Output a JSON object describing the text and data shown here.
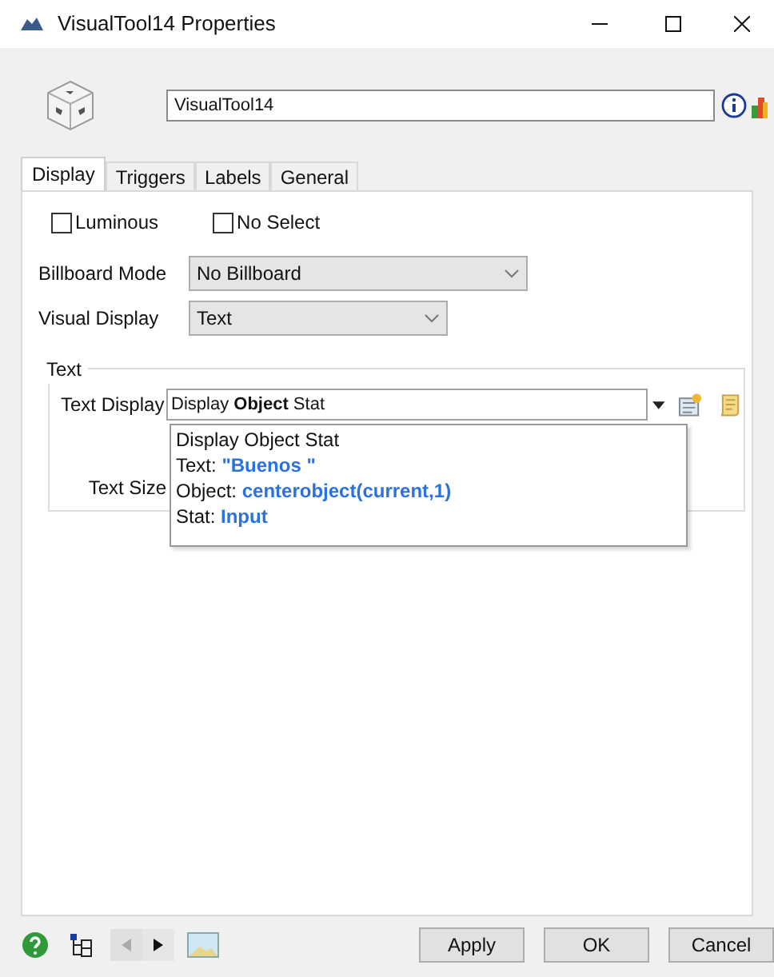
{
  "window": {
    "title": "VisualTool14  Properties"
  },
  "name_field": {
    "value": "VisualTool14"
  },
  "tabs": [
    {
      "label": "Display",
      "selected": true
    },
    {
      "label": "Triggers",
      "selected": false
    },
    {
      "label": "Labels",
      "selected": false
    },
    {
      "label": "General",
      "selected": false
    }
  ],
  "checkboxes": [
    {
      "label": "Luminous",
      "checked": false
    },
    {
      "label": "No Select",
      "checked": false
    }
  ],
  "billboard_mode": {
    "label": "Billboard Mode",
    "value": "No Billboard"
  },
  "visual_display": {
    "label": "Visual Display",
    "value": "Text"
  },
  "text_group": {
    "title": "Text",
    "text_display": {
      "label": "Text Display",
      "value": "Display **Object** Stat"
    },
    "text_size": {
      "label": "Text Size"
    },
    "popup": [
      {
        "label": "Display Object Stat"
      },
      {
        "label": "Text: ",
        "value": "\"Buenos \""
      },
      {
        "label": "Object: ",
        "value": "centerobject(current,1)"
      },
      {
        "label": "Stat: ",
        "value": "Input"
      }
    ]
  },
  "nav": [
    {
      "kind": "back",
      "disabled": true
    },
    {
      "kind": "forward",
      "disabled": false
    }
  ],
  "buttons": [
    "Apply",
    "OK",
    "Cancel"
  ]
}
